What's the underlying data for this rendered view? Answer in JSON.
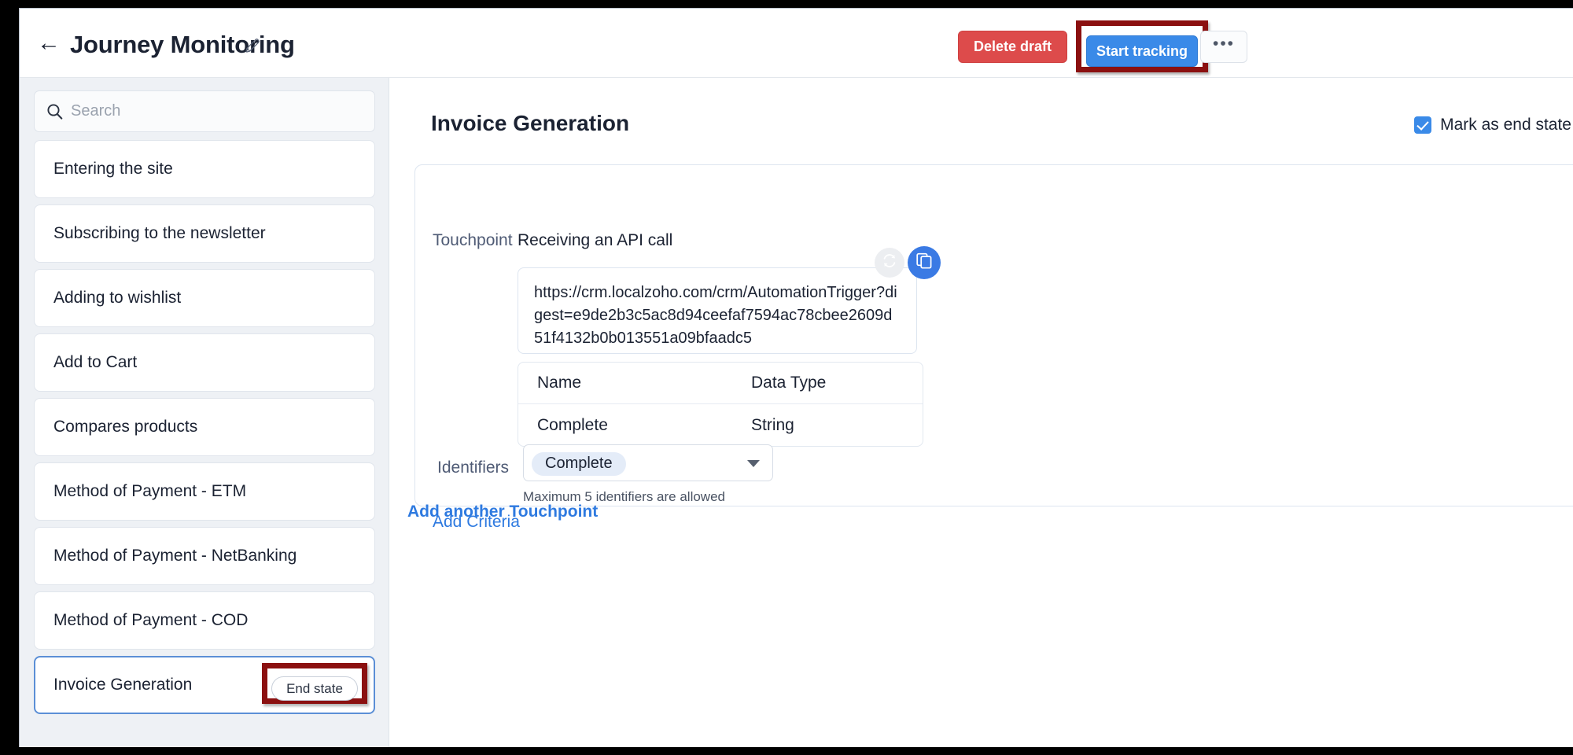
{
  "header": {
    "back_icon": "arrow-left-icon",
    "title": "Journey Monitoring",
    "edit_icon": "pencil-icon",
    "delete_draft_label": "Delete draft",
    "start_tracking_label": "Start tracking",
    "more_label": "•••",
    "accent_primary": "#3a8ae8",
    "accent_danger": "#dd4b4b",
    "annotation_color": "#8b1010"
  },
  "sidebar": {
    "search": {
      "icon": "search-icon",
      "placeholder": "Search",
      "value": ""
    },
    "items": [
      {
        "label": "Entering the site",
        "selected": false,
        "badge": null
      },
      {
        "label": "Subscribing to the newsletter",
        "selected": false,
        "badge": null
      },
      {
        "label": "Adding to wishlist",
        "selected": false,
        "badge": null
      },
      {
        "label": "Add to Cart",
        "selected": false,
        "badge": null
      },
      {
        "label": "Compares products",
        "selected": false,
        "badge": null
      },
      {
        "label": "Method of Payment - ETM",
        "selected": false,
        "badge": null
      },
      {
        "label": "Method of Payment - NetBanking",
        "selected": false,
        "badge": null
      },
      {
        "label": "Method of Payment - COD",
        "selected": false,
        "badge": null
      },
      {
        "label": "Invoice Generation",
        "selected": true,
        "badge": "End state"
      }
    ]
  },
  "main": {
    "title": "Invoice Generation",
    "mark_end_state_label": "Mark as end state",
    "mark_end_state_checked": true,
    "touchpoint": {
      "label": "Touchpoint",
      "value": "Receiving an API call",
      "url": "https://crm.localzoho.com/crm/AutomationTrigger?digest=e9de2b3c5ac8d94ceefaf7594ac78cbee2609d51f4132b0b013551a09bfaadc5",
      "regenerate_icon": "refresh-icon",
      "copy_icon": "copy-icon"
    },
    "params_table": {
      "columns": [
        "Name",
        "Data Type"
      ],
      "rows": [
        {
          "name": "Complete",
          "data_type": "String"
        }
      ]
    },
    "identifiers": {
      "label": "Identifiers",
      "selected": [
        "Complete"
      ],
      "caret_icon": "chevron-down-icon",
      "hint": "Maximum 5 identifiers are allowed"
    },
    "add_criteria_label": "Add Criteria",
    "add_another_touchpoint_label": "Add another Touchpoint"
  }
}
